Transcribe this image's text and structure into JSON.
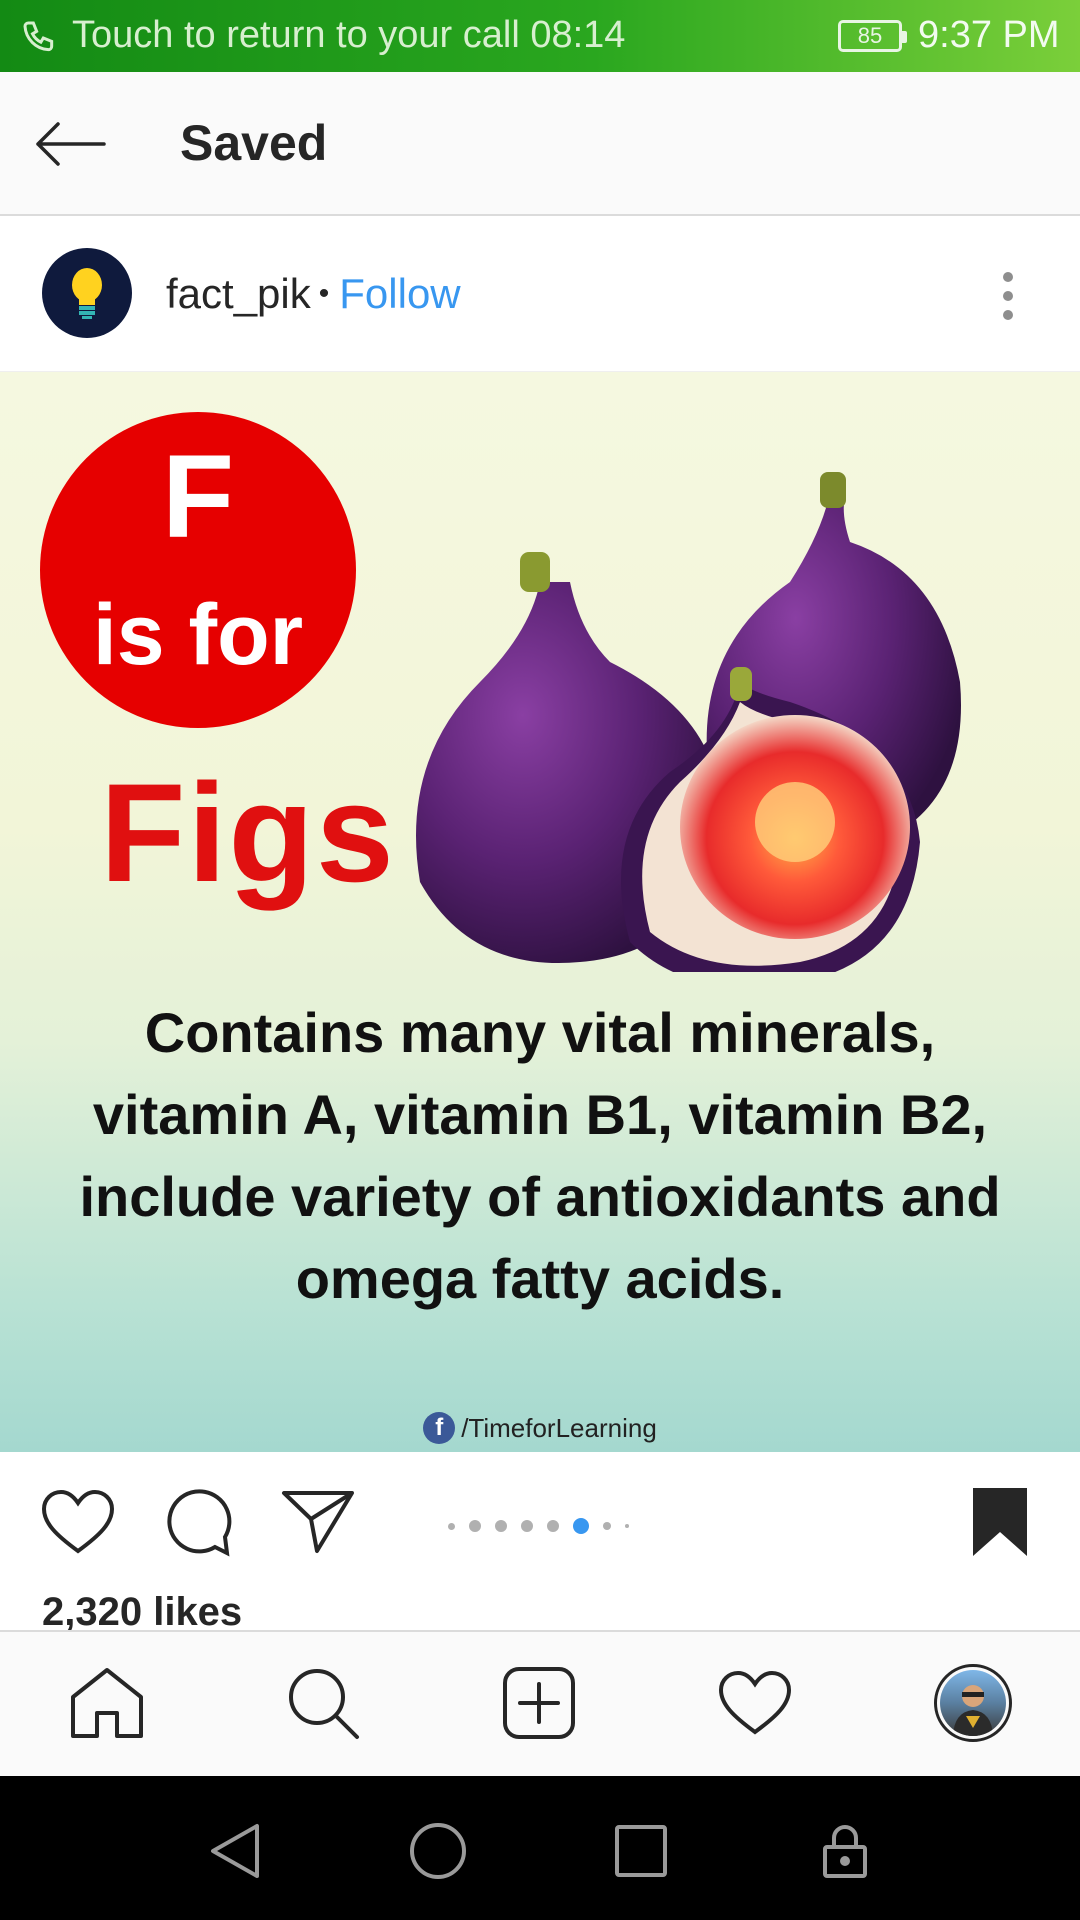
{
  "status_bar": {
    "call_text": "Touch to return to your call",
    "call_timer": "08:14",
    "battery": "85",
    "time": "9:37 PM"
  },
  "header": {
    "title": "Saved"
  },
  "post": {
    "username": "fact_pik",
    "separator": "•",
    "follow_label": "Follow",
    "image": {
      "letter": "F",
      "is_for": "is for",
      "word": "Figs",
      "caption": "Contains many vital minerals, vitamin A, vitamin B1, vitamin B2, include variety of antioxidants and omega fatty acids.",
      "credit": "/TimeforLearning",
      "credit_icon": "f"
    },
    "carousel": {
      "total_dots": 8,
      "active_index": 5
    },
    "likes": "2,320 likes"
  },
  "colors": {
    "accent": "#3897f0",
    "status_bar": "#2aa71f",
    "letter_red": "#e60000"
  },
  "icons": {
    "back": "arrow-left-icon",
    "more": "more-vertical-icon",
    "like": "heart-icon",
    "comment": "comment-icon",
    "share": "paper-plane-icon",
    "save": "bookmark-filled-icon",
    "home": "home-icon",
    "search": "search-icon",
    "add": "add-post-icon",
    "activity": "heart-icon",
    "profile": "profile-avatar"
  }
}
